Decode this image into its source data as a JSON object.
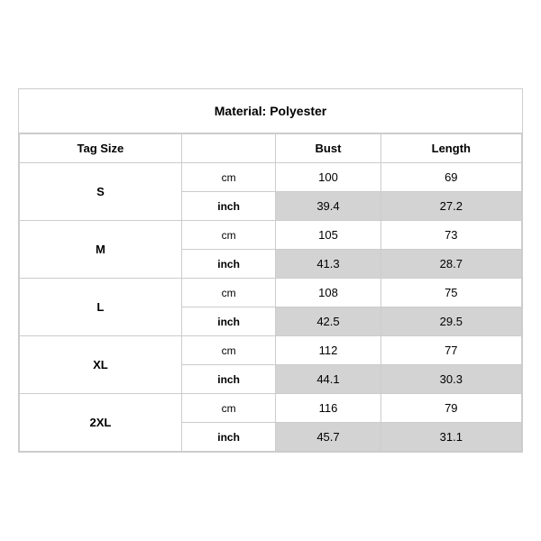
{
  "title": "Material: Polyester",
  "headers": {
    "tag_size": "Tag Size",
    "bust": "Bust",
    "length": "Length"
  },
  "sizes": [
    {
      "tag": "S",
      "cm": {
        "bust": "100",
        "length": "69"
      },
      "inch": {
        "bust": "39.4",
        "length": "27.2"
      }
    },
    {
      "tag": "M",
      "cm": {
        "bust": "105",
        "length": "73"
      },
      "inch": {
        "bust": "41.3",
        "length": "28.7"
      }
    },
    {
      "tag": "L",
      "cm": {
        "bust": "108",
        "length": "75"
      },
      "inch": {
        "bust": "42.5",
        "length": "29.5"
      }
    },
    {
      "tag": "XL",
      "cm": {
        "bust": "112",
        "length": "77"
      },
      "inch": {
        "bust": "44.1",
        "length": "30.3"
      }
    },
    {
      "tag": "2XL",
      "cm": {
        "bust": "116",
        "length": "79"
      },
      "inch": {
        "bust": "45.7",
        "length": "31.1"
      }
    }
  ],
  "labels": {
    "cm": "cm",
    "inch": "inch"
  }
}
